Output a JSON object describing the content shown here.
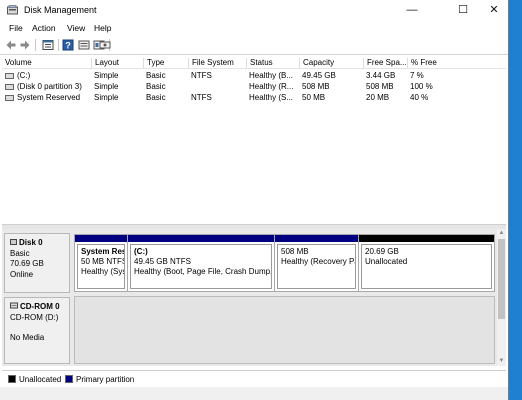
{
  "window": {
    "title": "Disk Management",
    "controls": {
      "minimize": "—",
      "maximize": "☐",
      "close": "✕"
    }
  },
  "menu": [
    "File",
    "Action",
    "View",
    "Help"
  ],
  "toolbar": {
    "icons": [
      "back-icon",
      "forward-icon",
      "properties-icon",
      "help-icon",
      "volume-list-icon",
      "disk-list-icon",
      "settings-icon"
    ]
  },
  "volume_list": {
    "columns": [
      "Volume",
      "Layout",
      "Type",
      "File System",
      "Status",
      "Capacity",
      "Free Spa...",
      "% Free"
    ],
    "rows": [
      [
        "(C:)",
        "Simple",
        "Basic",
        "NTFS",
        "Healthy (B...",
        "49.45 GB",
        "3.44 GB",
        "7 %"
      ],
      [
        "(Disk 0 partition 3)",
        "Simple",
        "Basic",
        "",
        "Healthy (R...",
        "508 MB",
        "508 MB",
        "100 %"
      ],
      [
        "System Reserved",
        "Simple",
        "Basic",
        "NTFS",
        "Healthy (S...",
        "50 MB",
        "20 MB",
        "40 %"
      ]
    ]
  },
  "disk0": {
    "name": "Disk 0",
    "type": "Basic",
    "size": "70.69 GB",
    "state": "Online",
    "partitions": [
      {
        "title": "System Res",
        "size": "50 MB NTFS",
        "status": "Healthy (Sys",
        "bar_color": "#000080"
      },
      {
        "title": "(C:)",
        "size": "49.45 GB NTFS",
        "status": "Healthy (Boot, Page File, Crash Dump,",
        "bar_color": "#000080"
      },
      {
        "title": "",
        "size": "508 MB",
        "status": "Healthy (Recovery Pa",
        "bar_color": "#000080"
      },
      {
        "title": "",
        "size": "20.69 GB",
        "status": "Unallocated",
        "bar_color": "#000000"
      }
    ]
  },
  "cdrom0": {
    "name": "CD-ROM 0",
    "drive": "CD-ROM (D:)",
    "media": "No Media"
  },
  "legend": [
    {
      "label": "Unallocated",
      "color": "#000000"
    },
    {
      "label": "Primary partition",
      "color": "#000080"
    }
  ]
}
